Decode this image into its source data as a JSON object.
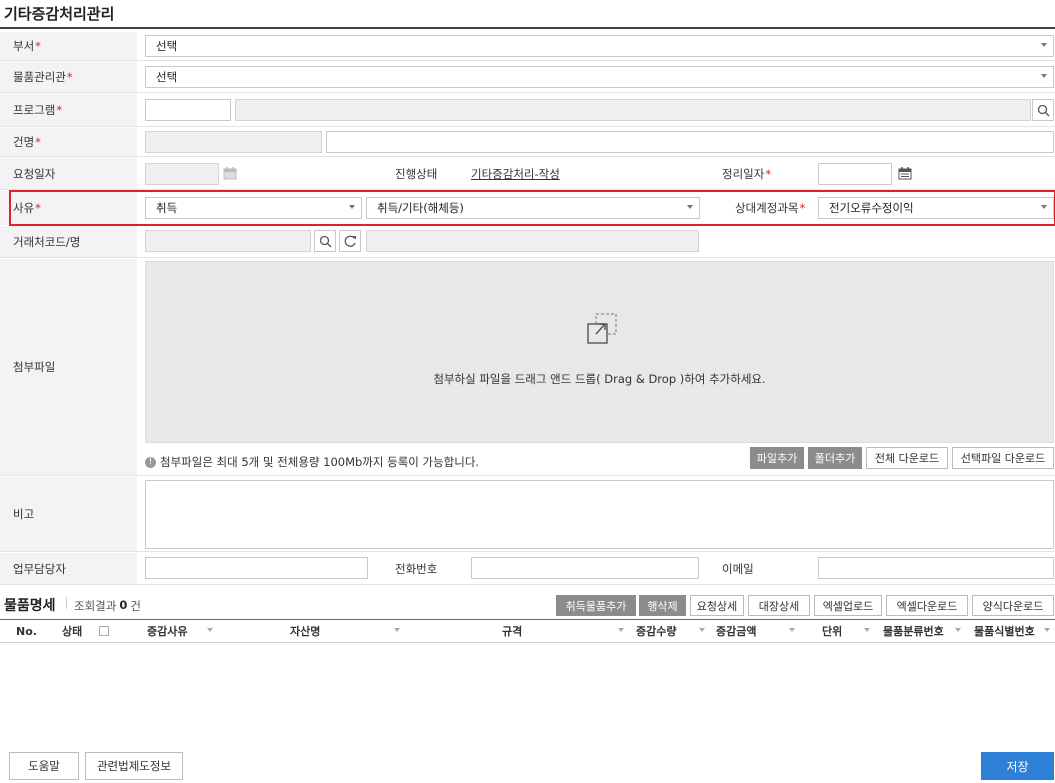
{
  "page": {
    "title": "기타증감처리관리"
  },
  "form": {
    "dept": {
      "label": "부서",
      "value": "선택"
    },
    "manager": {
      "label": "물품관리관",
      "value": "선택"
    },
    "program": {
      "label": "프로그램",
      "code": "",
      "name": ""
    },
    "subject": {
      "label": "건명",
      "code": "",
      "name": ""
    },
    "request_date": {
      "label": "요청일자",
      "value": ""
    },
    "status": {
      "label": "진행상태",
      "value": "기타증감처리-작성"
    },
    "settle_date": {
      "label": "정리일자",
      "value": ""
    },
    "reason": {
      "label": "사유",
      "value1": "취득",
      "value2": "취득/기타(해체등)",
      "account_label": "상대계정과목",
      "account_value": "전기오류수정이익",
      "highlight_color": "#d9232d"
    },
    "client": {
      "label": "거래처코드/명",
      "code": "",
      "name": ""
    },
    "attach": {
      "label": "첨부파일",
      "drop_text": "첨부하실 파일을 드래그 앤드 드롭( Drag & Drop )하여 추가하세요.",
      "info_text": "첨부파일은 최대 5개 및 전체용량 100Mb까지 등록이 가능합니다.",
      "buttons": {
        "add_file": "파일추가",
        "add_folder": "폴더추가",
        "download_all": "전체 다운로드",
        "download_selected": "선택파일 다운로드"
      }
    },
    "note": {
      "label": "비고",
      "value": ""
    },
    "staff": {
      "label": "업무담당자",
      "phone_label": "전화번호",
      "email_label": "이메일"
    }
  },
  "items": {
    "title": "물품명세",
    "count_label": "조회결과",
    "count": "0",
    "count_unit": "건",
    "buttons": {
      "add_acquire": "취득물품추가",
      "delete_row": "행삭제",
      "request_detail": "요청상세",
      "ledger_detail": "대장상세",
      "excel_upload": "엑셀업로드",
      "excel_download": "엑셀다운로드",
      "form_download": "양식다운로드"
    },
    "columns": [
      "No.",
      "상태",
      "증감사유",
      "자산명",
      "규격",
      "증감수량",
      "증감금액",
      "단위",
      "물품분류번호",
      "물품식별번호"
    ],
    "rows": []
  },
  "footer": {
    "help": "도움말",
    "law_info": "관련법제도정보",
    "save": "저장"
  },
  "colors": {
    "accent": "#2e7fd6",
    "required": "#e02020",
    "dark_button": "#8c8c8c"
  }
}
